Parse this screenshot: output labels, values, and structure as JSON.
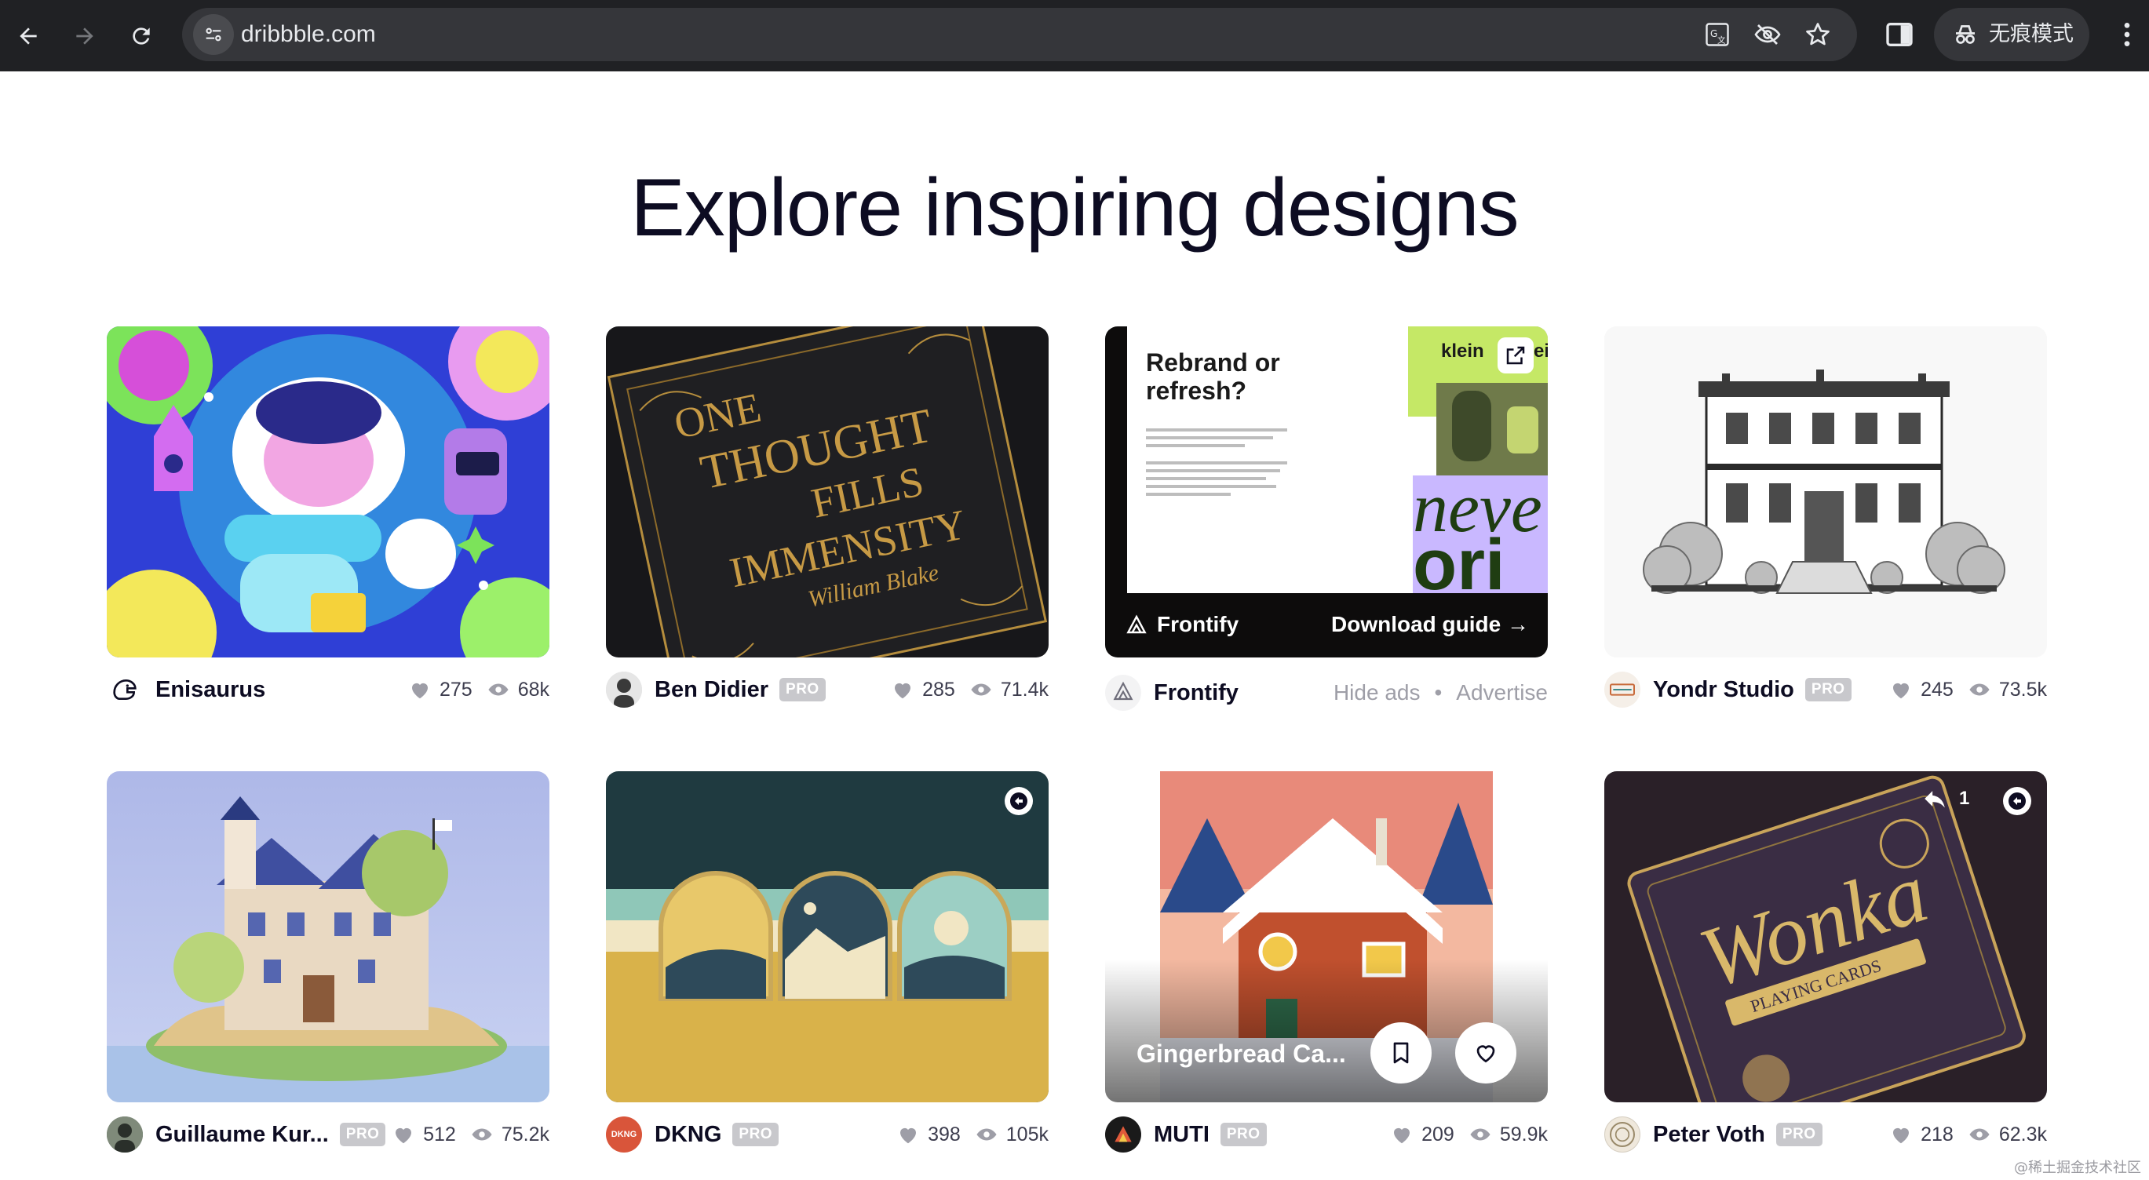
{
  "browser": {
    "url": "dribbble.com",
    "incognito_label": "无痕模式",
    "icons": [
      "back-icon",
      "forward-icon",
      "reload-icon",
      "site-info-icon",
      "translate-icon",
      "eye-off-icon",
      "star-icon",
      "side-panel-icon",
      "incognito-icon",
      "menu-icon"
    ]
  },
  "page": {
    "title": "Explore inspiring designs"
  },
  "shots": [
    {
      "author": "Enisaurus",
      "pro": "",
      "likes": "275",
      "views": "68k"
    },
    {
      "author": "Ben Didier",
      "pro": "PRO",
      "likes": "285",
      "views": "71.4k"
    },
    {
      "author": "Frontify",
      "pro": "",
      "sponsored": true
    },
    {
      "author": "Yondr Studio",
      "pro": "PRO",
      "likes": "245",
      "views": "73.5k"
    },
    {
      "author": "Guillaume Kur...",
      "pro": "PRO",
      "likes": "512",
      "views": "75.2k"
    },
    {
      "author": "DKNG",
      "pro": "PRO",
      "likes": "398",
      "views": "105k"
    },
    {
      "author": "MUTI",
      "pro": "PRO",
      "likes": "209",
      "views": "59.9k",
      "hover_title": "Gingerbread Ca..."
    },
    {
      "author": "Peter Voth",
      "pro": "PRO",
      "likes": "218",
      "views": "62.3k",
      "rebound_count": "1"
    }
  ],
  "ad": {
    "headline": "Rebrand or refresh?",
    "brand": "Frontify",
    "cta": "Download guide →",
    "hide_ads": "Hide ads",
    "separator": "•",
    "advertise": "Advertise",
    "big_text_1": "neve",
    "big_text_2": "ori",
    "tag": "klein",
    "tag_tail": "eig"
  },
  "artwork_text": {
    "book_line1": "ONE",
    "book_line2": "THOUGHT",
    "book_line3": "FILLS",
    "book_line4": "IMMENSITY",
    "book_author": "William Blake",
    "cards_title": "Wonka",
    "cards_sub": "PLAYING CARDS",
    "dkng_avatar": "DKNG"
  },
  "watermark": "@稀土掘金技术社区",
  "colors": {
    "chrome_bg": "#202124",
    "omnibox_bg": "#35363a",
    "text_primary": "#0d0c22",
    "muted": "#9e9ea7",
    "pro_badge": "#c8c8cc",
    "frontify_green": "#c5e866",
    "frontify_purple": "#c9b8ff"
  }
}
